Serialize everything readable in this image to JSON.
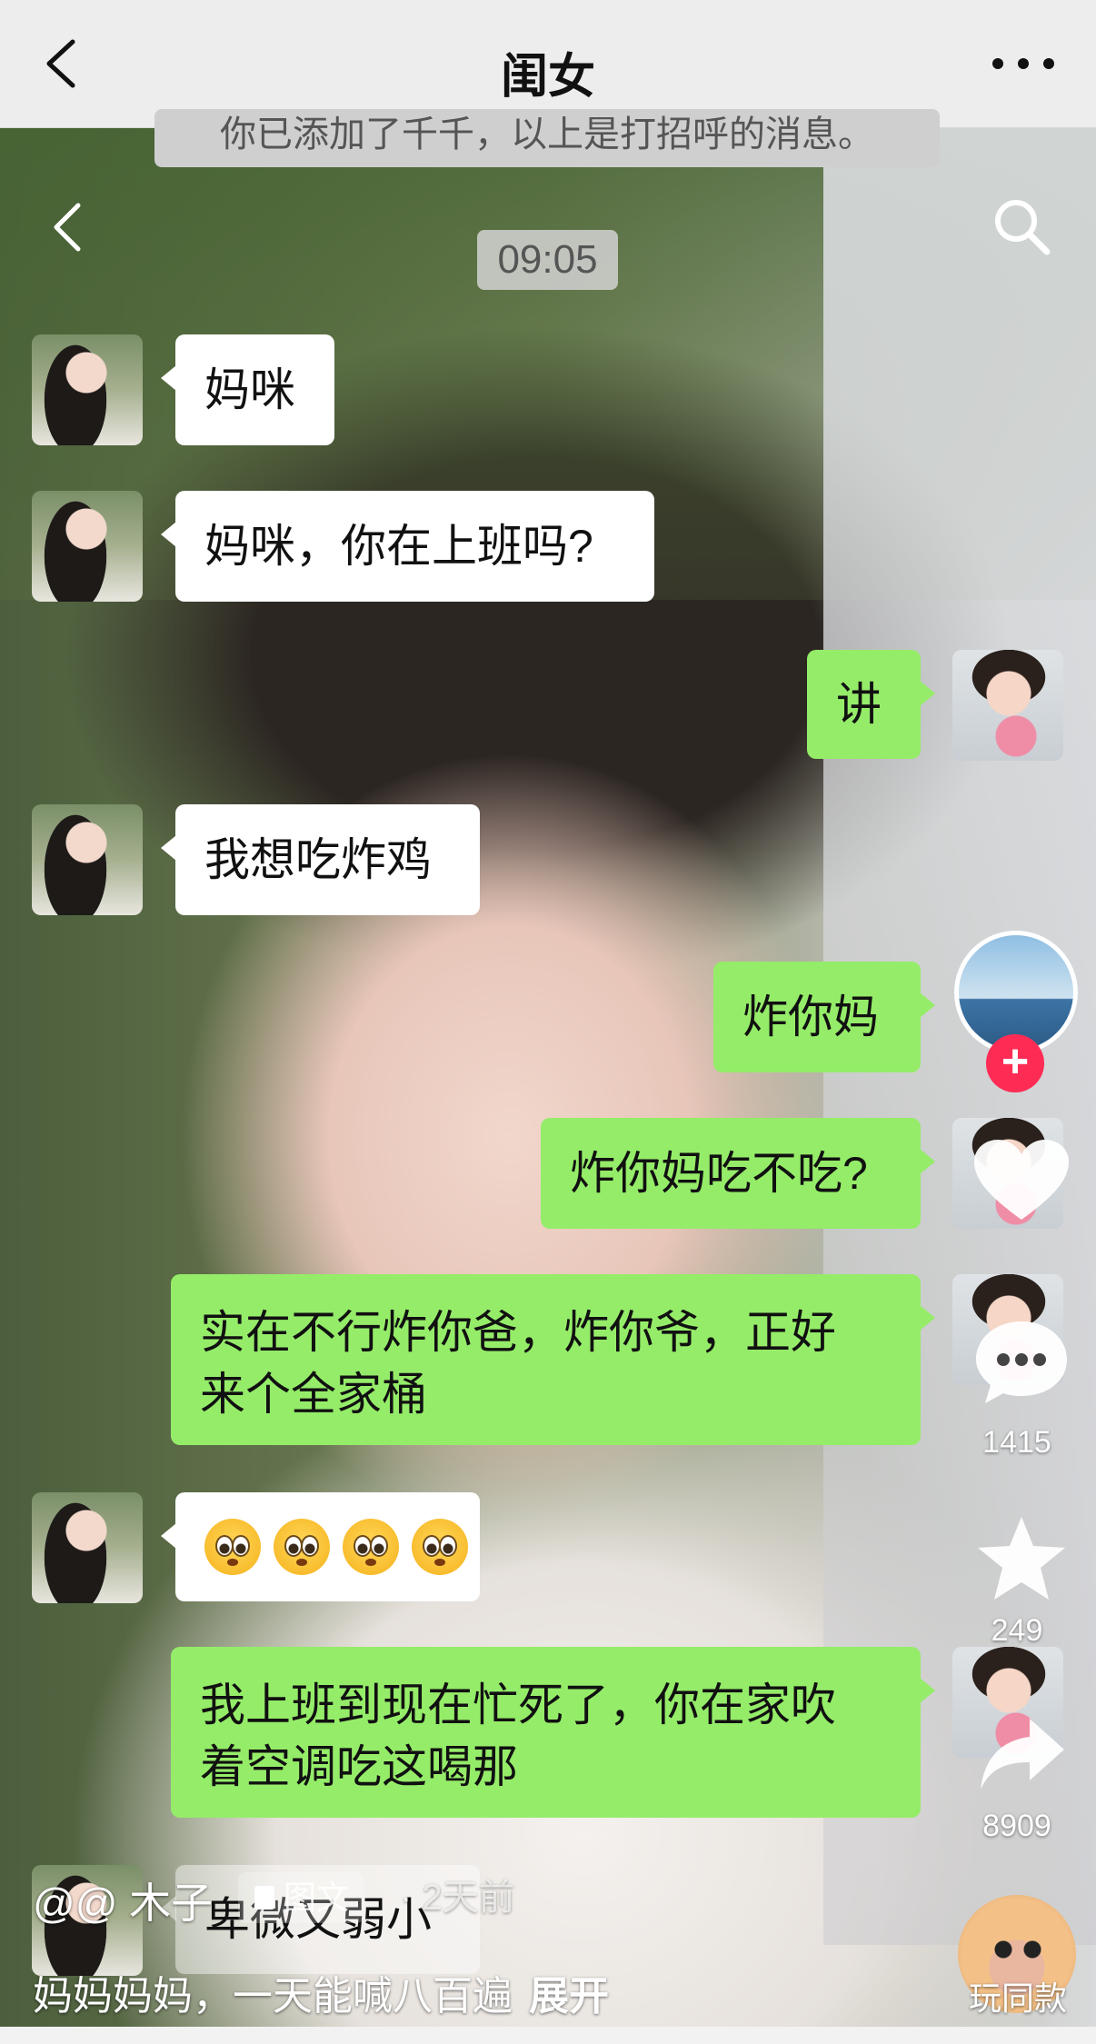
{
  "wechat": {
    "title": "闺女",
    "system_message": "你已添加了千千，以上是打招呼的消息。",
    "timestamp": "09:05"
  },
  "messages": [
    {
      "side": "in",
      "text": "妈咪"
    },
    {
      "side": "in",
      "text": "妈咪，你在上班吗?"
    },
    {
      "side": "out",
      "text": "讲"
    },
    {
      "side": "in",
      "text": "我想吃炸鸡"
    },
    {
      "side": "out",
      "text": "炸你妈"
    },
    {
      "side": "out",
      "text": "炸你妈吃不吃?"
    },
    {
      "side": "out",
      "text_line1": "实在不行炸你爸，炸你爷，正好",
      "text_line2": "来个全家桶"
    },
    {
      "side": "in",
      "emoji": "flushed-face",
      "count": 4
    },
    {
      "side": "out",
      "text_line1": "我上班到现在忙死了，你在家吹",
      "text_line2": "着空调吃这喝那"
    },
    {
      "side": "in",
      "text": "卑微又弱小"
    }
  ],
  "tiktok": {
    "follow_symbol": "+",
    "comments_count": "1415",
    "favorites_count": "249",
    "shares_count": "8909",
    "disc_label": "玩同款",
    "author": "@@ 木子",
    "tag_label": "图文",
    "time_ago": "· 2天前",
    "caption": "妈妈妈妈，一天能喊八百遍",
    "expand_label": "展开"
  },
  "colors": {
    "bubble_out": "#95ec69",
    "bubble_in": "#ffffff",
    "follow_button": "#fe2c55"
  }
}
